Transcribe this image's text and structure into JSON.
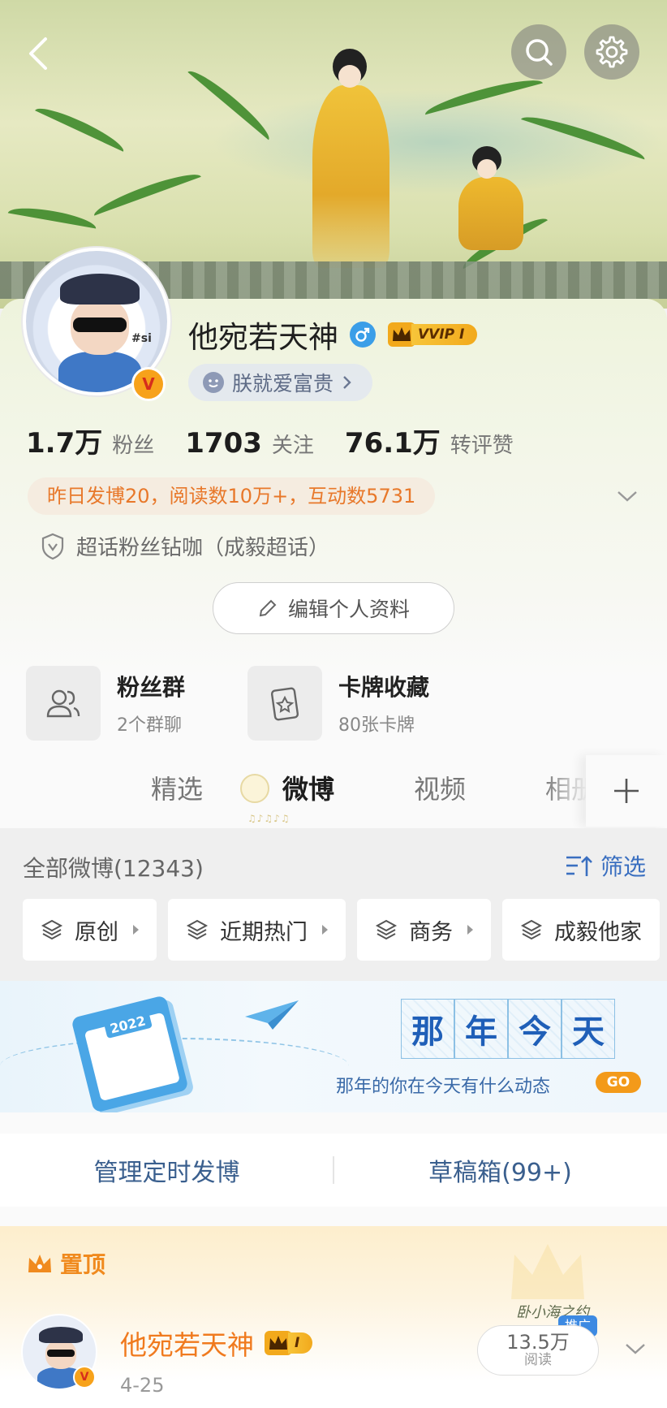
{
  "header": {
    "back_icon": "chevron-left-icon",
    "search_icon": "search-icon",
    "settings_icon": "gear-icon"
  },
  "profile": {
    "username": "他宛若天神",
    "gender_icon": "male-icon",
    "vip_label": "VVIP I",
    "verified_badge": "V",
    "avatar_tag": "#si",
    "status": "朕就爱富贵",
    "stats": [
      {
        "value": "1.7万",
        "label": "粉丝"
      },
      {
        "value": "1703",
        "label": "关注"
      },
      {
        "value": "76.1万",
        "label": "转评赞"
      }
    ],
    "activity": "昨日发博20，阅读数10万+，互动数5731",
    "super_topic": "超话粉丝钻咖（成毅超话）",
    "edit_label": "编辑个人资料"
  },
  "features": [
    {
      "title": "粉丝群",
      "subtitle": "2个群聊",
      "icon": "group-icon"
    },
    {
      "title": "卡牌收藏",
      "subtitle": "80张卡牌",
      "icon": "card-icon"
    }
  ],
  "tabs": [
    {
      "label": "精选",
      "active": false
    },
    {
      "label": "微博",
      "active": true
    },
    {
      "label": "视频",
      "active": false
    },
    {
      "label": "相册",
      "active": false
    }
  ],
  "tab_deco_text": "♫♪♫♪♫",
  "filter": {
    "all_label": "全部微博(12343)",
    "filter_label": "筛选",
    "chips": [
      "原创",
      "近期热门",
      "商务",
      "成毅他家"
    ]
  },
  "memory": {
    "title_chars": [
      "那",
      "年",
      "今",
      "天"
    ],
    "subtitle": "那年的你在今天有什么动态",
    "go_label": "GO",
    "calendar_year": "2022"
  },
  "schedule": {
    "manage_label": "管理定时发博",
    "draft_label": "草稿箱(99+)"
  },
  "pinned_post": {
    "pin_label": "置顶",
    "author": "他宛若天神",
    "vip_label": "I",
    "date": "4-25",
    "promo_tag": "推广",
    "promo_art_text": "卧小海之约",
    "read_count": "13.5万",
    "read_label": "阅读"
  },
  "colors": {
    "accent_orange": "#f08a1e",
    "link_blue": "#3a6fc0",
    "vip_gold": "#f2a91c",
    "male_blue": "#3b9ee8"
  }
}
